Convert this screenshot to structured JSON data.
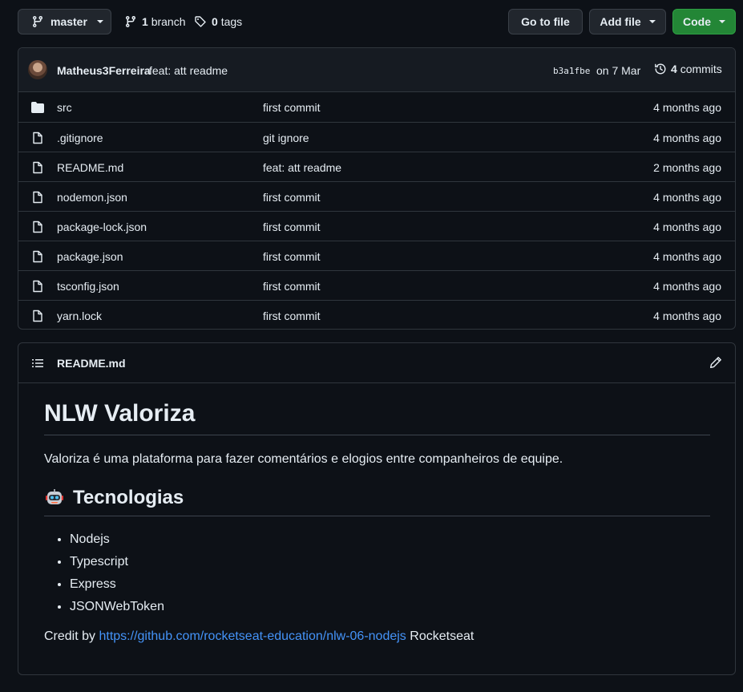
{
  "toolbar": {
    "branch_button": "master",
    "branches_count": "1",
    "branches_label": "branch",
    "tags_count": "0",
    "tags_label": "tags",
    "goto_file": "Go to file",
    "add_file": "Add file",
    "code": "Code"
  },
  "latest_commit": {
    "author": "Matheus3Ferreira",
    "message": "feat: att readme",
    "sha": "b3a1fbe",
    "date": "on 7 Mar",
    "commits_count": "4",
    "commits_label": "commits"
  },
  "files": [
    {
      "name": "src",
      "type": "folder",
      "message": "first commit",
      "age": "4 months ago"
    },
    {
      "name": ".gitignore",
      "type": "file",
      "message": "git ignore",
      "age": "4 months ago"
    },
    {
      "name": "README.md",
      "type": "file",
      "message": "feat: att readme",
      "age": "2 months ago"
    },
    {
      "name": "nodemon.json",
      "type": "file",
      "message": "first commit",
      "age": "4 months ago"
    },
    {
      "name": "package-lock.json",
      "type": "file",
      "message": "first commit",
      "age": "4 months ago"
    },
    {
      "name": "package.json",
      "type": "file",
      "message": "first commit",
      "age": "4 months ago"
    },
    {
      "name": "tsconfig.json",
      "type": "file",
      "message": "first commit",
      "age": "4 months ago"
    },
    {
      "name": "yarn.lock",
      "type": "file",
      "message": "first commit",
      "age": "4 months ago"
    }
  ],
  "readme": {
    "filename": "README.md",
    "title": "NLW Valoriza",
    "description": "Valoriza é uma plataforma para fazer comentários e elogios entre companheiros de equipe.",
    "tech_heading": "Tecnologias",
    "technologies": [
      "Nodejs",
      "Typescript",
      "Express",
      "JSONWebToken"
    ],
    "credit_prefix": "Credit by",
    "credit_link": "https://github.com/rocketseat-education/nlw-06-nodejs",
    "credit_suffix": "Rocketseat"
  },
  "icons": {
    "branch": "git-branch-icon",
    "tag": "tag-icon",
    "history": "history-icon",
    "folder": "folder-icon",
    "file": "file-icon",
    "list": "list-icon",
    "pencil": "pencil-icon",
    "robot": "robot-emoji"
  },
  "colors": {
    "background": "#0d1117",
    "code_button": "#238636",
    "link": "#4493f8"
  }
}
